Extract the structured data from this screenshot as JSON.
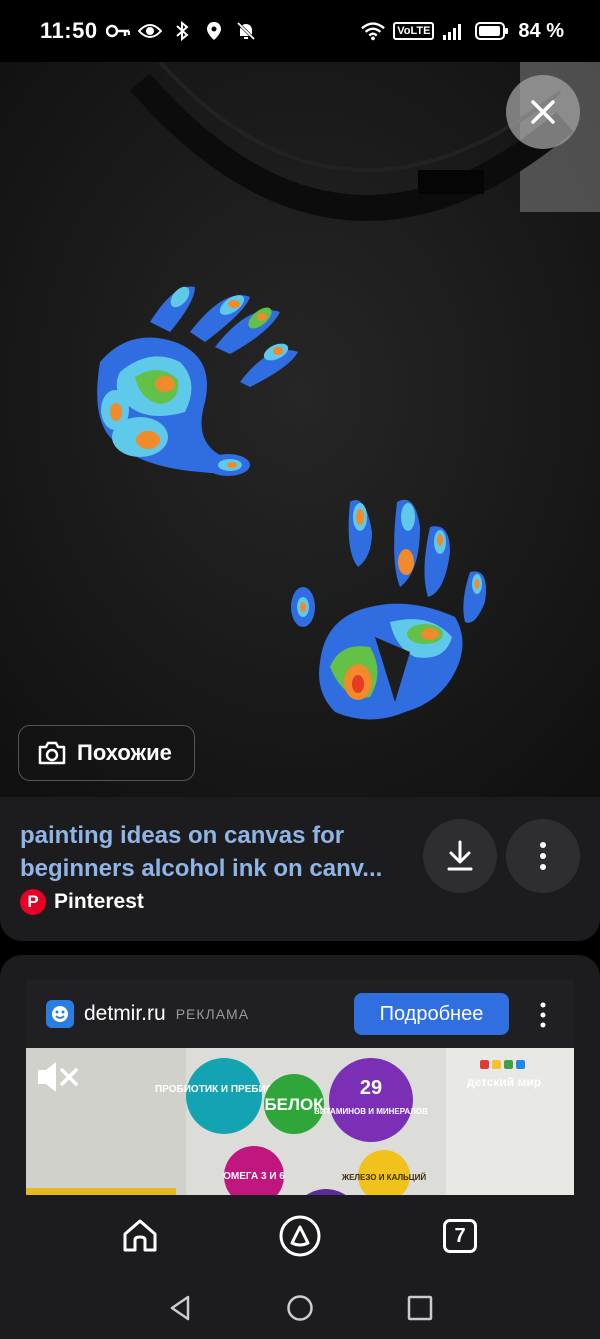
{
  "status_bar": {
    "time": "11:50",
    "network": "VoLTE",
    "battery": "84 %",
    "icons": [
      "key-icon",
      "eye-icon",
      "bluetooth-icon",
      "location-icon",
      "mute-icon",
      "wifi-icon",
      "signal-icon",
      "battery-icon"
    ]
  },
  "image_viewer": {
    "close_icon": "close-icon",
    "similar_button_label": "Похожие",
    "similar_icon": "camera-search-icon"
  },
  "result": {
    "title": "painting ideas on canvas for beginners alcohol ink on canv...",
    "source": "Pinterest",
    "download_icon": "download-icon",
    "more_icon": "more-vertical-icon"
  },
  "ad": {
    "domain": "detmir.ru",
    "label": "РЕКЛАМА",
    "cta_label": "Подробнее",
    "mute_icon": "muted-speaker-icon",
    "brand_logo_text": "детский мир",
    "badges": [
      "ПРОБИОТИК И ПРЕБИОТИК",
      "БЕЛОК",
      "29",
      "ВИТАМИНОВ И МИНЕРАЛОВ",
      "ОМЕГА 3 И 6",
      "ЖЕЛЕЗО И КАЛЬЦИЙ"
    ],
    "colors": {
      "cta": "#2f6fe0",
      "badge_teal": "#13a3b3",
      "badge_green": "#2fa63a",
      "badge_purple": "#7a2fb4",
      "badge_magenta": "#c0167d",
      "badge_yellow": "#f2c21c"
    }
  },
  "bottom_nav": {
    "home_icon": "home-icon",
    "assistant_icon": "alice-icon",
    "tabs_count": "7"
  },
  "system_nav": [
    "back-icon",
    "home-circle-icon",
    "recents-icon"
  ]
}
